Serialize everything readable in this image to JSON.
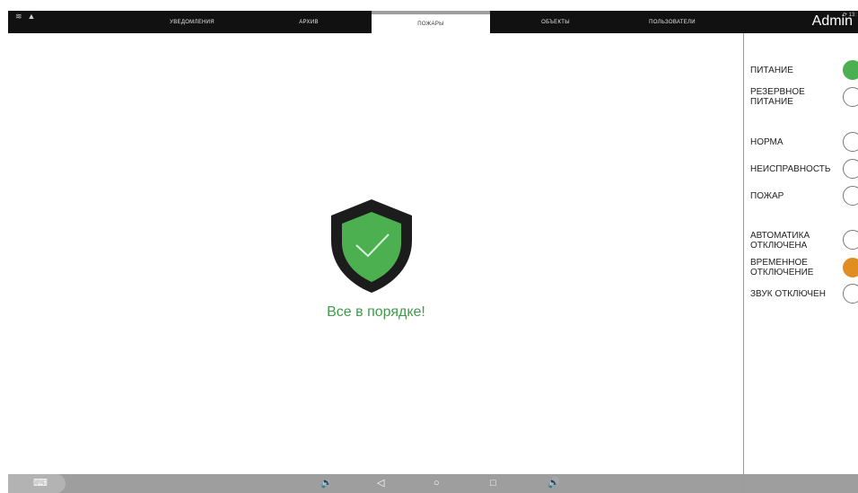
{
  "statusbar": {
    "left_icons": [
      "wifi-icon",
      "warning-icon"
    ],
    "time": "13:",
    "right_icons": [
      "sync-icon",
      "settings-icon"
    ]
  },
  "tabs": [
    {
      "label": "УВЕДОМЛЕНИЯ",
      "active": false
    },
    {
      "label": "АРХИВ",
      "active": false
    },
    {
      "label": "ПОЖАРЫ",
      "active": true
    },
    {
      "label": "ОБЪЕКТЫ",
      "active": false
    },
    {
      "label": "ПОЛЬЗОВАТЕЛИ",
      "active": false
    }
  ],
  "user": {
    "name": "Admin"
  },
  "main": {
    "status_icon": "shield-check-icon",
    "status_text": "Все в порядке!",
    "status_color": "#3f9b4a"
  },
  "indicators": [
    {
      "label": "ПИТАНИЕ",
      "state": "on",
      "color": "#4caf50"
    },
    {
      "label": "РЕЗЕРВНОЕ ПИТАНИЕ",
      "state": "off"
    },
    {
      "label": "НОРМА",
      "state": "off"
    },
    {
      "label": "НЕИСПРАВНОСТЬ",
      "state": "off"
    },
    {
      "label": "ПОЖАР",
      "state": "off"
    },
    {
      "label": "АВТОМАТИКА ОТКЛЮЧЕНА",
      "state": "off"
    },
    {
      "label": "ВРЕМЕННОЕ ОТКЛЮЧЕНИЕ",
      "state": "on",
      "color": "#e08d21"
    },
    {
      "label": "ЗВУК ОТКЛЮЧЕН",
      "state": "off"
    }
  ],
  "navbar": {
    "buttons": [
      "keyboard-icon",
      "volume-down-icon",
      "back-icon",
      "home-icon",
      "recents-icon",
      "volume-up-icon"
    ]
  }
}
